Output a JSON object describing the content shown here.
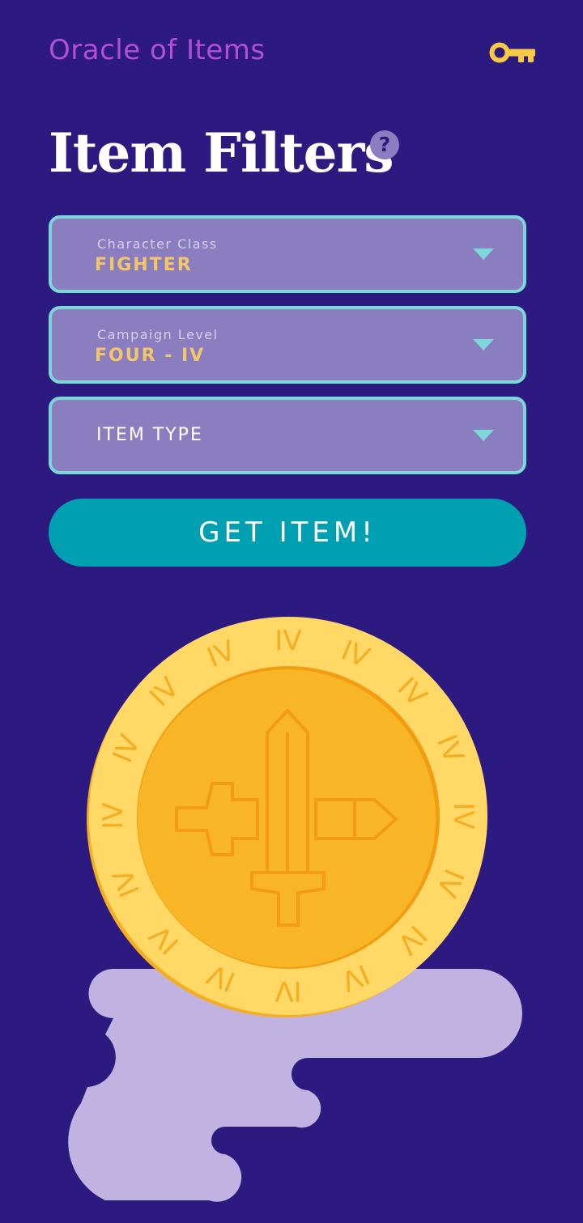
{
  "app": {
    "title": "Oracle of Items",
    "key_icon": "key-icon"
  },
  "page": {
    "title": "Item Filters",
    "help_glyph": "?"
  },
  "filters": {
    "character_class": {
      "label": "Character Class",
      "value": "FIGHTER"
    },
    "campaign_level": {
      "label": "Campaign Level",
      "value": "FOUR - IV"
    },
    "item_type": {
      "placeholder": "ITEM TYPE"
    }
  },
  "actions": {
    "get_item": "GET ITEM!"
  },
  "coin": {
    "rim_numeral": "IV",
    "emblem": "sword-icon"
  },
  "colors": {
    "background": "#2c1a80",
    "app_title": "#b24fd6",
    "key": "#f7c944",
    "select_bg": "#8a7dc0",
    "select_border": "#7dd6d8",
    "select_value": "#f3c667",
    "button": "#009fb2",
    "coin_outer": "#ffd866",
    "coin_inner": "#f8b526",
    "coin_stroke": "#f39c12",
    "cloud": "#c0b3e2"
  }
}
